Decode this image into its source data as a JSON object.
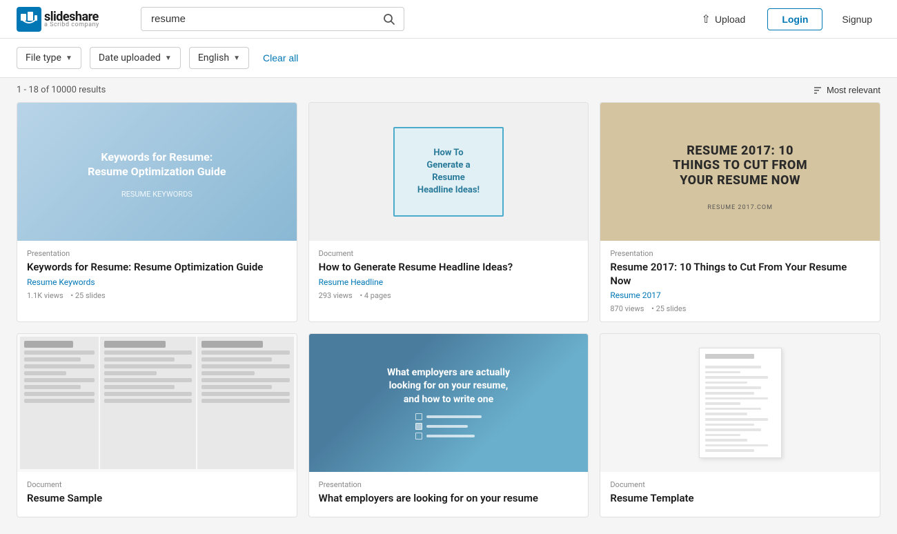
{
  "header": {
    "logo_text": "slideshare",
    "logo_sub": "a Scribd company",
    "search_placeholder": "resume",
    "search_value": "resume",
    "upload_label": "Upload",
    "login_label": "Login",
    "signup_label": "Signup"
  },
  "filters": {
    "file_type_label": "File type",
    "date_uploaded_label": "Date uploaded",
    "language_label": "English",
    "clear_all_label": "Clear all"
  },
  "results": {
    "summary": "1 - 18 of 10000 results",
    "sort_label": "Most relevant"
  },
  "cards": [
    {
      "id": 1,
      "type": "Presentation",
      "title": "Keywords for Resume: Resume Optimization Guide",
      "author": "Resume Keywords",
      "views": "1.1K views",
      "extra": "25 slides",
      "thumb_style": "thumb-1"
    },
    {
      "id": 2,
      "type": "Document",
      "title": "How to Generate Resume Headline Ideas?",
      "author": "Resume Headline",
      "views": "293 views",
      "extra": "4 pages",
      "thumb_style": "thumb-2"
    },
    {
      "id": 3,
      "type": "Presentation",
      "title": "Resume 2017: 10 Things to Cut From Your Resume Now",
      "author": "Resume 2017",
      "views": "870 views",
      "extra": "25 slides",
      "thumb_style": "thumb-3"
    },
    {
      "id": 4,
      "type": "Document",
      "title": "Resume Sample",
      "author": "",
      "views": "",
      "extra": "",
      "thumb_style": "thumb-4"
    },
    {
      "id": 5,
      "type": "Presentation",
      "title": "What employers are looking for on your resume",
      "author": "",
      "views": "",
      "extra": "",
      "thumb_style": "thumb-5"
    },
    {
      "id": 6,
      "type": "Document",
      "title": "Resume Template",
      "author": "",
      "views": "",
      "extra": "",
      "thumb_style": "thumb-6"
    }
  ]
}
